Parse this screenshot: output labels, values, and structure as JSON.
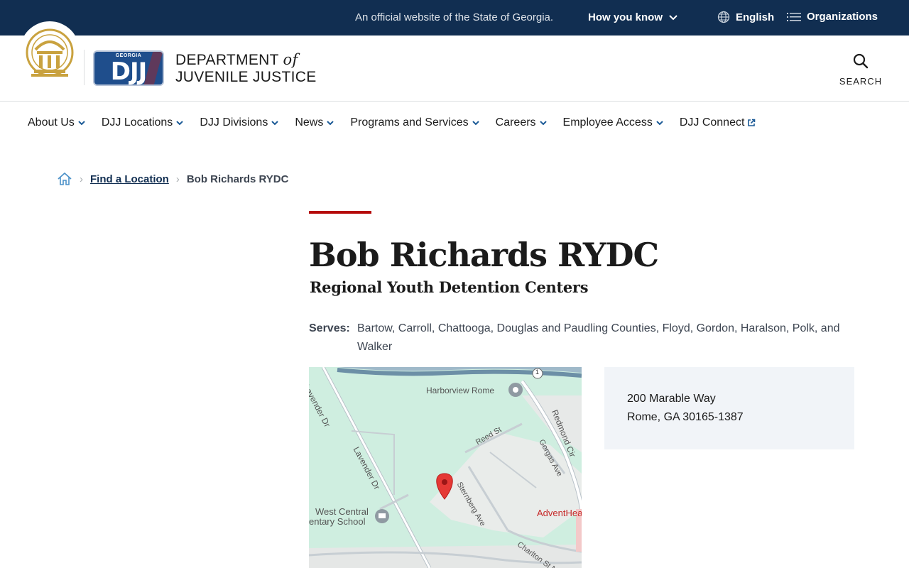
{
  "topbar": {
    "official_text": "An official website of the State of Georgia.",
    "how_you_know": "How you know",
    "language": "English",
    "organizations": "Organizations"
  },
  "header": {
    "logo_small_text": "GEORGIA",
    "logo_text": "DJJ",
    "dept_line1": "DEPARTMENT",
    "dept_of": "of",
    "dept_line2": "JUVENILE JUSTICE",
    "search_label": "SEARCH"
  },
  "nav": {
    "items": [
      {
        "label": "About Us"
      },
      {
        "label": "DJJ Locations"
      },
      {
        "label": "DJJ Divisions"
      },
      {
        "label": "News"
      },
      {
        "label": "Programs and Services"
      },
      {
        "label": "Careers"
      },
      {
        "label": "Employee Access"
      },
      {
        "label": "DJJ Connect"
      }
    ]
  },
  "breadcrumb": {
    "link": "Find a Location",
    "current": "Bob Richards RYDC"
  },
  "main": {
    "title": "Bob Richards RYDC",
    "subtitle": "Regional Youth Detention Centers",
    "serves_label": "Serves:",
    "serves_value": "Bartow, Carroll, Chattooga, Douglas and Paudling Counties, Floyd, Gordon, Haralson, Polk, and Walker"
  },
  "map": {
    "labels": {
      "harborview": "Harborview Rome",
      "lavender1": "Lavender Dr",
      "lavender2": "Lavender Dr",
      "redmond": "Redmond Cir",
      "reed": "Reed St",
      "gorgas": "Gorgas Ave",
      "sternberg": "Sternberg Ave",
      "westcentral1": "West Central",
      "westcentral2": "entary School",
      "advent": "AdventHea",
      "charlton": "Charlton St NW",
      "route": "1"
    }
  },
  "address": {
    "line1": "200 Marable Way",
    "line2": "Rome, GA 30165-1387"
  },
  "colors": {
    "topbar": "#112e51",
    "accent": "#b50909",
    "address_bg": "#f1f4f8",
    "map_green": "#cfeee0"
  }
}
